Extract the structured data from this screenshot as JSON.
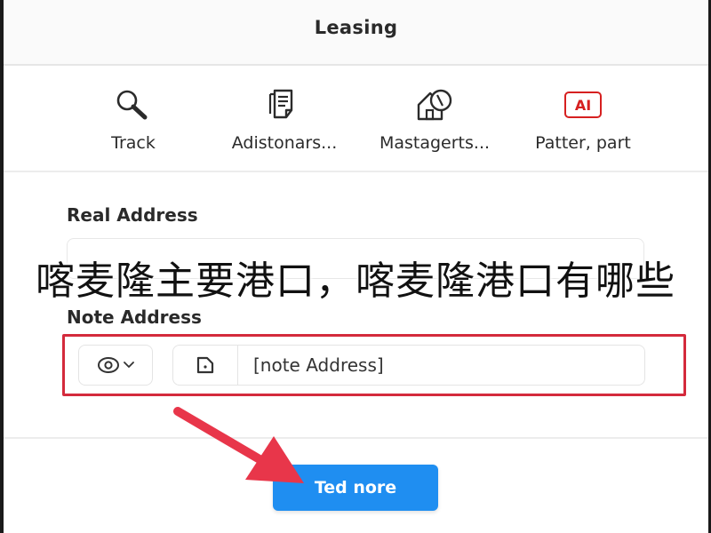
{
  "header": {
    "title": "Leasing"
  },
  "toolbar": {
    "items": [
      {
        "label": "Track",
        "icon": "magnifier-icon"
      },
      {
        "label": "Adistonars...",
        "icon": "document-list-icon"
      },
      {
        "label": "Mastagerts...",
        "icon": "home-shield-icon"
      },
      {
        "label": "Patter, part",
        "icon": "ai-badge-icon",
        "badge": "AI"
      }
    ]
  },
  "form": {
    "real_address": {
      "label": "Real Address",
      "placeholder": ""
    },
    "note_address": {
      "label": "Note Address",
      "value": "[note Address]"
    }
  },
  "overlay_text": "喀麦隆主要港口，喀麦隆港口有哪些",
  "cta": {
    "label": "Ted nore"
  },
  "colors": {
    "accent": "#1f8ef1",
    "highlight": "#d42a3c",
    "arrow": "#e8364a",
    "ai_badge": "#d62020"
  }
}
